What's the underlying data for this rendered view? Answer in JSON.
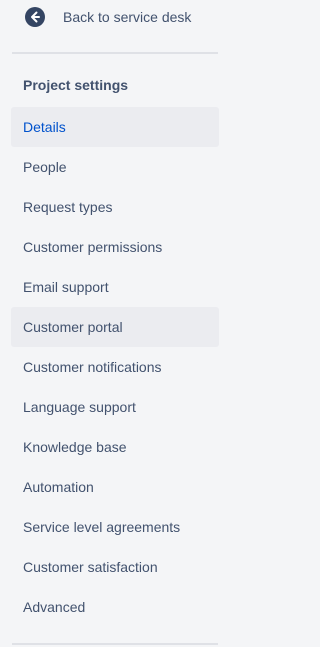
{
  "back": {
    "label": "Back to service desk",
    "icon": "arrow-left-circle-icon",
    "icon_color": "#344563"
  },
  "section": {
    "title": "Project settings"
  },
  "nav": {
    "items": [
      {
        "label": "Details",
        "state": "active"
      },
      {
        "label": "People",
        "state": "default"
      },
      {
        "label": "Request types",
        "state": "default"
      },
      {
        "label": "Customer permissions",
        "state": "default"
      },
      {
        "label": "Email support",
        "state": "default"
      },
      {
        "label": "Customer portal",
        "state": "hover"
      },
      {
        "label": "Customer notifications",
        "state": "default"
      },
      {
        "label": "Language support",
        "state": "default"
      },
      {
        "label": "Knowledge base",
        "state": "default"
      },
      {
        "label": "Automation",
        "state": "default"
      },
      {
        "label": "Service level agreements",
        "state": "default"
      },
      {
        "label": "Customer satisfaction",
        "state": "default"
      },
      {
        "label": "Advanced",
        "state": "default"
      }
    ]
  },
  "colors": {
    "background": "#f4f5f7",
    "text": "#42526e",
    "active_text": "#0052cc",
    "item_highlight": "#ebecf0",
    "divider": "#dfe1e6"
  }
}
